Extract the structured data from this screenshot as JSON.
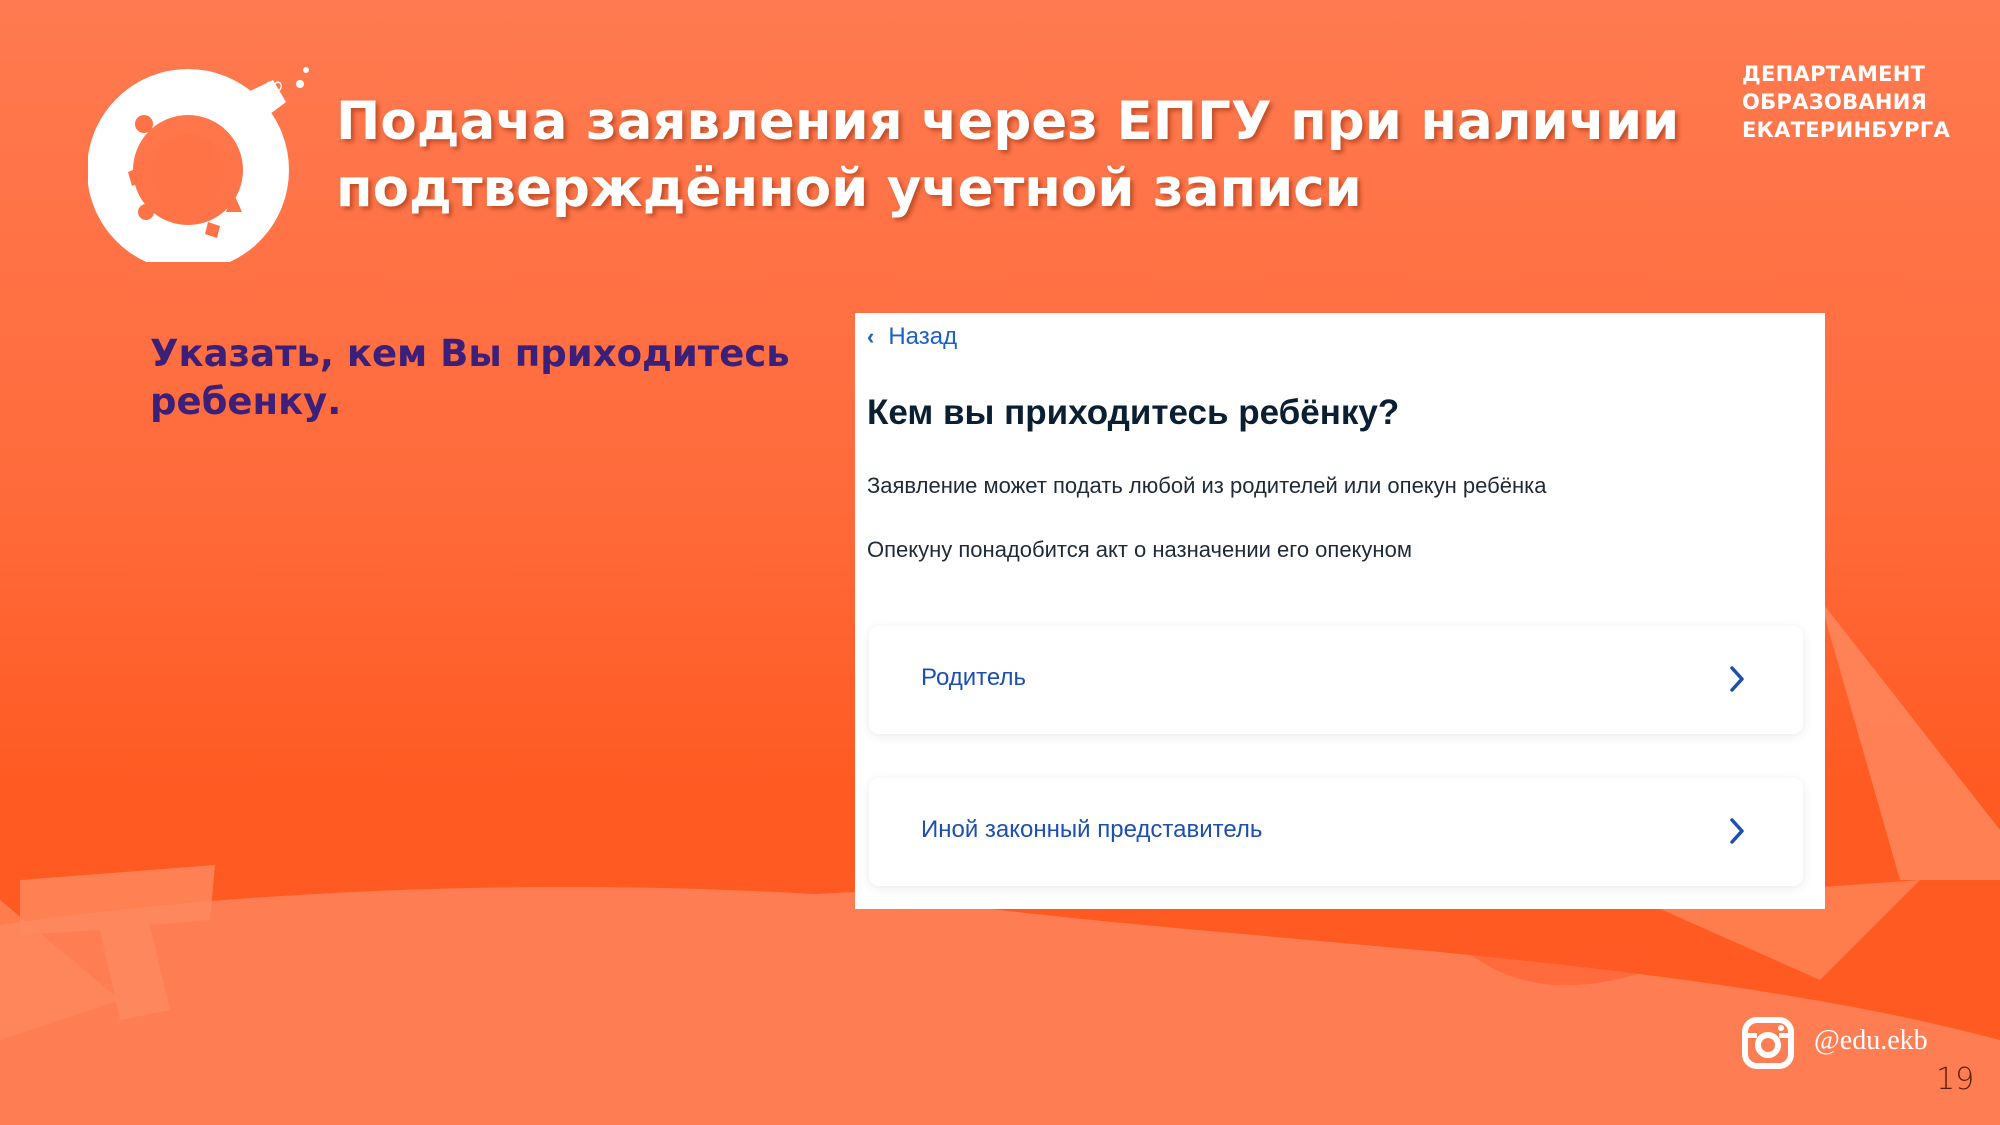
{
  "slide": {
    "title_lines": [
      "Подача заявления через ЕПГУ при наличии",
      "подтверждённой учетной записи"
    ],
    "department_lines": [
      "ДЕПАРТАМЕНТ",
      "ОБРАЗОВАНИЯ",
      "ЕКАТЕРИНБУРГА"
    ],
    "instruction_lines": [
      "Указать, кем Вы приходитесь",
      "ребенку."
    ],
    "social_handle": "@edu.ekb",
    "social_icon": "instagram-icon",
    "page_number": "19"
  },
  "form": {
    "back_label": "Назад",
    "heading": "Кем вы приходитесь ребёнку?",
    "text1": "Заявление может подать любой из родителей или опекун ребёнка",
    "text2": "Опекуну понадобится акт о назначении его опекуном",
    "options": [
      {
        "label": "Родитель"
      },
      {
        "label": "Иной законный представитель"
      }
    ]
  },
  "colors": {
    "background": "#ff6a3a",
    "title": "#ffffff",
    "instruction": "#3b1f78",
    "link": "#1d5fc8"
  }
}
